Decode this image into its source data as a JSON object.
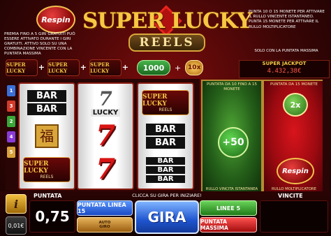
{
  "header": {
    "respin_logo": "Respin",
    "title": "SUPER LUCKY",
    "subtitle": "REELS",
    "promo_left": "PREMIA FINO A 5 GIRI GRATUITI PUÒ ESSERE ATTIVATO DURANTE I GIRI GRATUITI. ATTIVO SOLO SU UNA COMBINAZIONE VINCENTE CON LA PUNTATA MASSIMA",
    "promo_right": "PUNTA 10 O 15 MONETE PER ATTIVARE IL RULLO VINCENTE ISTANTANEO. PUNTA 15 MONETE PER ATTIVARE IL RULLO MOLTIPLICATORE",
    "promo_right_note": "SOLO CON LA PUNTATA MASSIMA"
  },
  "strip": {
    "mini_logo_label": "SUPER LUCKY",
    "plus": "+",
    "bonus_value": "1000",
    "multiplier_value": "10x"
  },
  "jackpot": {
    "label": "SUPER JACKPOT",
    "value": "4.432,38€"
  },
  "paylines": [
    "1",
    "3",
    "2",
    "4",
    "5"
  ],
  "paylines_colors": [
    "#3b6fd8",
    "#d23a2a",
    "#3aa63a",
    "#8a3ad8",
    "#d8a23a"
  ],
  "reels": {
    "bar": "BAR",
    "seven": "7",
    "lucky": "LUCKY",
    "wild_title": "SUPER LUCKY",
    "wild_sub": "REELS",
    "fu": "福"
  },
  "features": {
    "instant_title": "PUNTATA DA 10 FINO A 15 MONETE",
    "instant_badge": "+50",
    "instant_footer": "RULLO VINCITA ISTANTANEA",
    "multi_title": "PUNTATA DA 15 MONETE",
    "multi_badge": "2x",
    "multi_respin": "Respin",
    "multi_footer": "RULLO MOLTIPLICATORE"
  },
  "bottom": {
    "info": "i",
    "coin": "0,01€",
    "bet_label": "PUNTATA",
    "bet_value": "0,75",
    "hint": "CLICCA SU GIRA PER INIZIARE!",
    "line_bet": "PUNTATA LINEA 15",
    "auto_line1": "AUTO",
    "auto_line2": "GIRO",
    "spin": "GIRA",
    "lines": "LINEE 5",
    "max_bet": "PUNTATA MASSIMA",
    "win_label": "VINCITE"
  }
}
